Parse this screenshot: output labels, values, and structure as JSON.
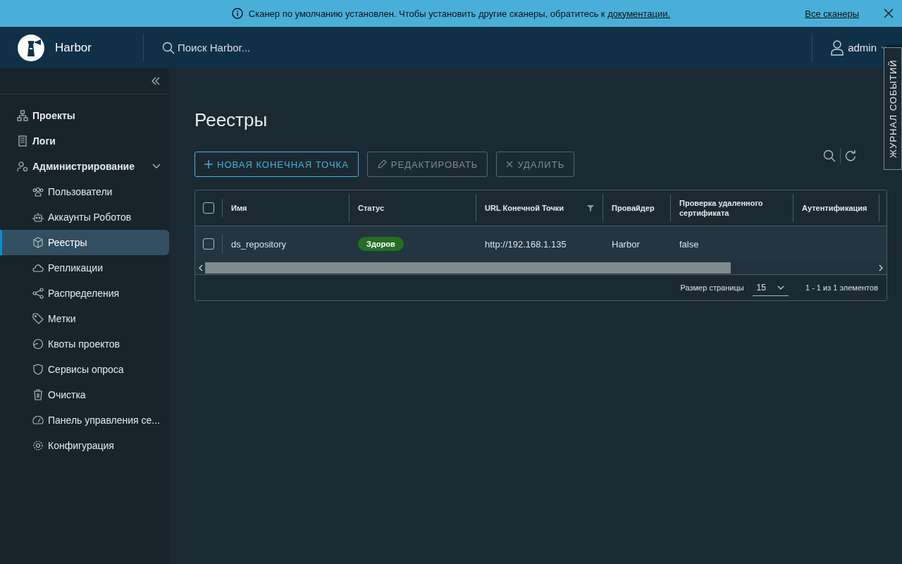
{
  "banner": {
    "message": "Сканер по умолчанию установлен. Чтобы установить другие сканеры, обратитесь к",
    "link": "документации.",
    "action": "Все сканеры"
  },
  "header": {
    "brand": "Harbor",
    "search": {
      "placeholder": "Поиск Harbor..."
    },
    "user": "admin"
  },
  "event_log": {
    "label": "ЖУРНАЛ СОБЫТИЙ"
  },
  "sidebar": {
    "items": [
      {
        "label": "Проекты",
        "selected": false
      },
      {
        "label": "Логи",
        "selected": false
      },
      {
        "label": "Администрирование",
        "selected": false,
        "expanded": true,
        "children": [
          {
            "label": "Пользователи",
            "selected": false
          },
          {
            "label": "Аккаунты Роботов",
            "selected": false
          },
          {
            "label": "Реестры",
            "selected": true
          },
          {
            "label": "Репликации",
            "selected": false
          },
          {
            "label": "Распределения",
            "selected": false
          },
          {
            "label": "Метки",
            "selected": false
          },
          {
            "label": "Квоты проектов",
            "selected": false
          },
          {
            "label": "Сервисы опроса",
            "selected": false
          },
          {
            "label": "Очистка",
            "selected": false
          },
          {
            "label": "Панель управления се...",
            "selected": false
          },
          {
            "label": "Конфигурация",
            "selected": false
          }
        ]
      }
    ]
  },
  "page": {
    "title": "Реестры"
  },
  "toolbar": {
    "buttons": [
      {
        "label": "НОВАЯ КОНЕЧНАЯ ТОЧКА",
        "disabled": false
      },
      {
        "label": "РЕДАКТИРОВАТЬ",
        "disabled": true
      },
      {
        "label": "УДАЛИТЬ",
        "disabled": true
      }
    ]
  },
  "table": {
    "select_all": {
      "checked": false
    },
    "columns": [
      {
        "label": "Имя"
      },
      {
        "label": "Статус"
      },
      {
        "label": "URL Конечной Точки",
        "filter": true
      },
      {
        "label": "Провайдер"
      },
      {
        "label": "Проверка удаленного сертификата"
      },
      {
        "label": "Аутентификация"
      }
    ],
    "rows": [
      {
        "checked": false,
        "name": "ds_repository",
        "status": "Здоров",
        "url": "http://192.168.1.135",
        "provider": "Harbor",
        "verify": "false",
        "auth": ""
      }
    ],
    "footer": {
      "page_size_label": "Размер страницы",
      "page_size": "15",
      "range": "1 - 1 из 1 элементов"
    }
  }
}
